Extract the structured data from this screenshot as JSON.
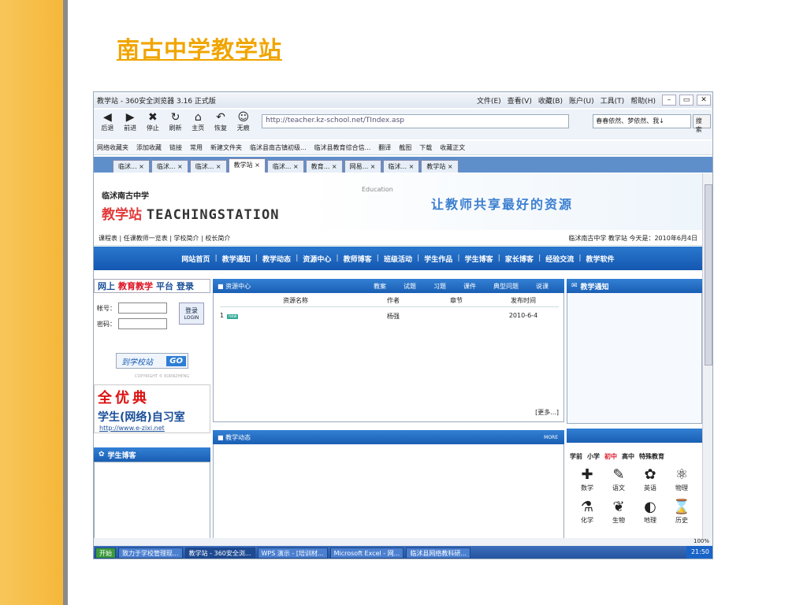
{
  "slide": {
    "title": "南古中学教学站"
  },
  "browser": {
    "title": "教学站 - 360安全浏览器 3.16 正式版",
    "menus": [
      "文件(E)",
      "查看(V)",
      "收藏(B)",
      "账户(U)",
      "工具(T)",
      "帮助(H)"
    ],
    "nav": [
      {
        "label": "后退",
        "icon": "◀"
      },
      {
        "label": "前进",
        "icon": "▶"
      },
      {
        "label": "停止",
        "icon": "✖"
      },
      {
        "label": "刷新",
        "icon": "↻"
      },
      {
        "label": "主页",
        "icon": "⌂"
      },
      {
        "label": "恢复",
        "icon": "↶"
      },
      {
        "label": "无痕",
        "icon": "☺"
      }
    ],
    "address": "http://teacher.kz-school.net/TIndex.asp",
    "search_value": "春春依然、梦依然、我↓",
    "search_button": "搜索",
    "favorites": [
      "网络收藏夹",
      "添加收藏",
      "链接",
      "常用",
      "新建文件夹",
      "临沭县南古镇初级...",
      "临沭县教育综合信...",
      "翻译",
      "截图",
      "下载",
      "收藏正文"
    ],
    "tabs": [
      "临沭... ×",
      "临沭... ×",
      "临沭... ×",
      "教学站 ×",
      "临沭... ×",
      "教育... ×",
      "网易... ×",
      "临沭... ×",
      "教学站 ×"
    ],
    "active_tab": 3,
    "zoom": "100%"
  },
  "site": {
    "school_name": "临沭南古中学",
    "logo_cn": "教学站",
    "logo_en": "TEACHINGSTATION",
    "edu_label": "Education",
    "slogan": "让教师共享最好的资源",
    "top_links": "课程表 | 任课教师一览表 | 学校简介 | 校长简介",
    "top_right": "临沭南古中学  教学站  今天是：2010年6月4日",
    "main_nav": [
      "网站首页",
      "教学通知",
      "教学动态",
      "资源中心",
      "教师博客",
      "班级活动",
      "学生作品",
      "学生博客",
      "家长博客",
      "经验交流",
      "教学软件"
    ],
    "portal": {
      "prefix": "网上",
      "brand": "教育教学",
      "suffix": "平台",
      "login": "登录"
    },
    "login": {
      "account_label": "帐号：",
      "password_label": "密码：",
      "button": "登录",
      "button_sub": "LOGIN"
    },
    "go_school": {
      "label": "到学校站",
      "btn": "GO"
    },
    "copyright": "COPYRIGHT © KURNZHENG",
    "ad": {
      "line1": "全优典",
      "line2": "学生(网络)自习室",
      "url": "http://www.e-zixi.net"
    },
    "student_blog": "学生博客",
    "resource": {
      "header": "■ 资源中心",
      "tabs": [
        "教案",
        "试题",
        "习题",
        "课件",
        "典型问题",
        "说课"
      ],
      "columns": [
        "资源名称",
        "作者",
        "章节",
        "发布时间"
      ],
      "rows": [
        {
          "no": "1",
          "badge": "new",
          "name": "",
          "author": "杨强",
          "chapter": "",
          "date": "2010-6-4"
        }
      ],
      "more": "[更多...]"
    },
    "dynamics": {
      "header": "■ 教学动态",
      "more": "MORE"
    },
    "notice": "教学通知",
    "subjects": {
      "tabs": [
        "学前",
        "小学",
        "初中",
        "高中",
        "特殊教育"
      ],
      "active": "初中",
      "items": [
        {
          "name": "数学",
          "icon": "✚"
        },
        {
          "name": "语文",
          "icon": "✎"
        },
        {
          "name": "英语",
          "icon": "✿"
        },
        {
          "name": "物理",
          "icon": "⚛"
        },
        {
          "name": "化学",
          "icon": "⚗"
        },
        {
          "name": "生物",
          "icon": "❦"
        },
        {
          "name": "地理",
          "icon": "◐"
        },
        {
          "name": "历史",
          "icon": "⌛"
        }
      ]
    }
  },
  "taskbar": {
    "start": "开始",
    "items": [
      "致力于学校管理现...",
      "教学站 - 360安全浏...",
      "WPS 演示 - [培训材...",
      "Microsoft Excel - 网...",
      "临沭县网络教科研..."
    ],
    "active": 1,
    "clock": "21:50"
  }
}
